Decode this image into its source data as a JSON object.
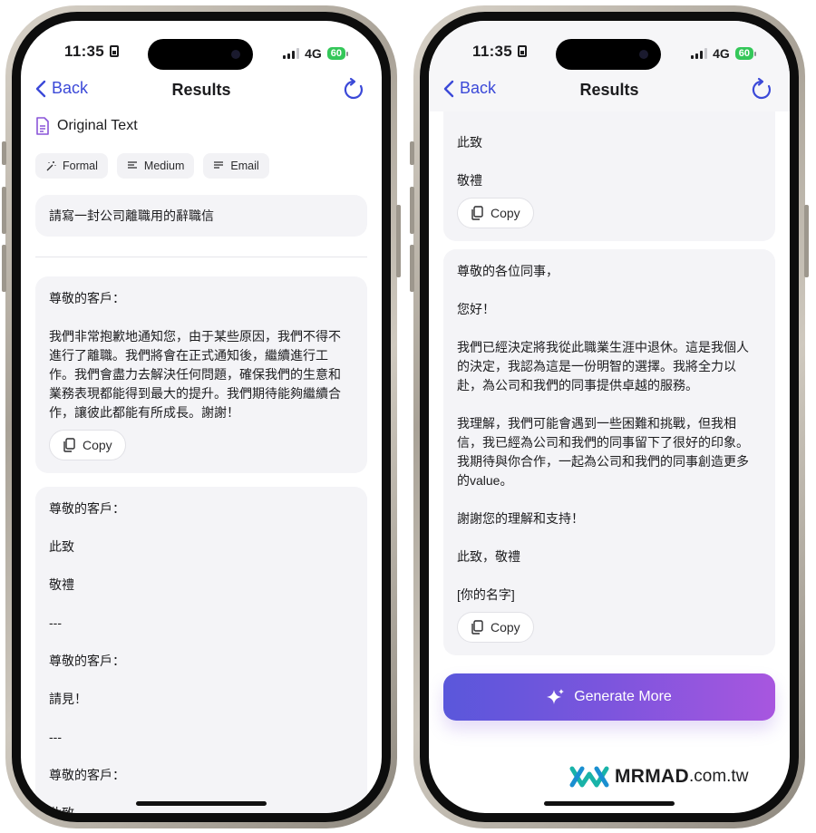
{
  "status": {
    "time": "11:35",
    "network": "4G",
    "battery": "60"
  },
  "nav": {
    "back_label": "Back",
    "title": "Results"
  },
  "left": {
    "original_label": "Original Text",
    "chips": [
      "Formal",
      "Medium",
      "Email"
    ],
    "prompt": "請寫一封公司離職用的辭職信",
    "card1": {
      "lines": [
        "尊敬的客戶：",
        "",
        "我們非常抱歉地通知您，由于某些原因，我們不得不",
        "進行了離職。我們將會在正式通知後，繼續進行工",
        "作。我們會盡力去解決任何問題，確保我們的生意和",
        "業務表現都能得到最大的提升。我們期待能夠繼續合",
        "作，讓彼此都能有所成長。謝謝！"
      ]
    },
    "card2": {
      "lines": [
        "尊敬的客戶：",
        "",
        "此致",
        "",
        "敬禮",
        "",
        "---",
        "",
        "尊敬的客戶：",
        "",
        "請見！",
        "",
        "---",
        "",
        "尊敬的客戶：",
        "",
        "此致"
      ]
    }
  },
  "right": {
    "card_top": {
      "lines": [
        "此致",
        "",
        "敬禮"
      ]
    },
    "card_main": {
      "lines": [
        "尊敬的各位同事，",
        "",
        "您好！",
        "",
        "我們已經決定將我從此職業生涯中退休。這是我個人",
        "的決定，我認為這是一份明智的選擇。我將全力以",
        "赴，為公司和我們的同事提供卓越的服務。",
        "",
        "我理解，我們可能會遇到一些困難和挑戰，但我相",
        "信，我已經為公司和我們的同事留下了很好的印象。",
        "我期待與你合作，一起為公司和我們的同事創造更多",
        "的value。",
        "",
        "謝謝您的理解和支持！",
        "",
        "此致，敬禮",
        "",
        "[你的名字]"
      ]
    },
    "generate_label": "Generate More"
  },
  "copy_label": "Copy",
  "watermark": {
    "brand": "MRMAD",
    "domain": ".com.tw"
  },
  "colors": {
    "accent": "#3b49d8",
    "card_bg": "#f4f4f7",
    "gradient_start": "#5a57db",
    "gradient_end": "#a856df"
  }
}
